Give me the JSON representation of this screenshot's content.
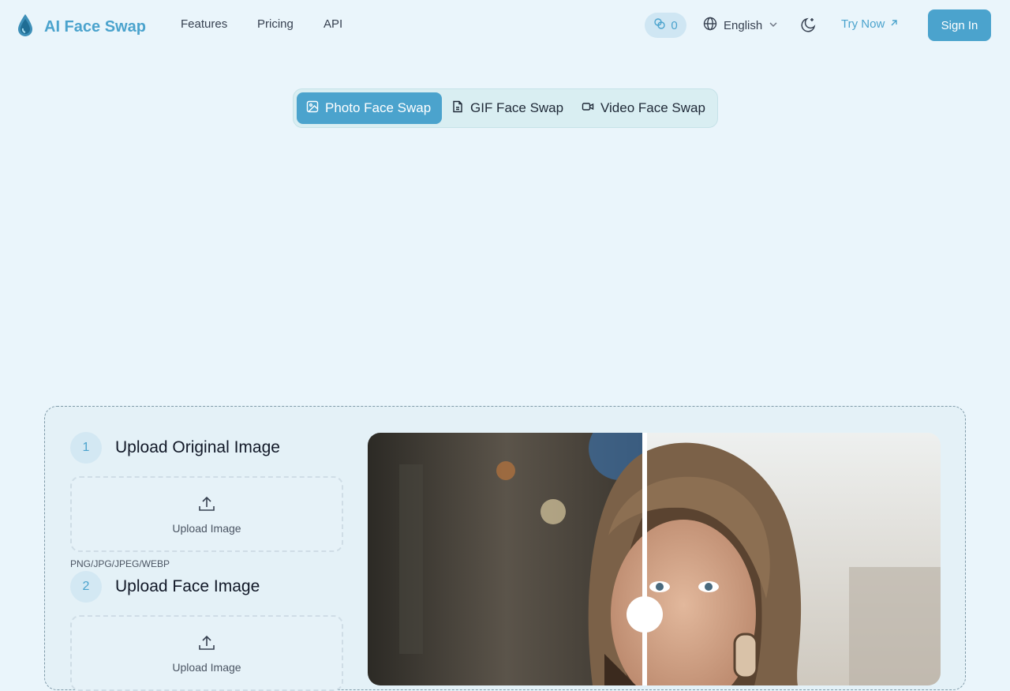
{
  "brand": {
    "name": "AI Face Swap",
    "icon": "water-drop-logo"
  },
  "nav": {
    "features": "Features",
    "pricing": "Pricing",
    "api": "API",
    "credits": "0",
    "language": "English",
    "try_now": "Try Now",
    "sign_in": "Sign In"
  },
  "tabs": [
    {
      "label": "Photo Face Swap",
      "icon": "image-icon",
      "active": true
    },
    {
      "label": "GIF Face Swap",
      "icon": "file-icon",
      "active": false
    },
    {
      "label": "Video Face Swap",
      "icon": "video-icon",
      "active": false
    }
  ],
  "steps": [
    {
      "number": "1",
      "title": "Upload Original Image",
      "upload_label": "Upload Image",
      "hint": "PNG/JPG/JPEG/WEBP"
    },
    {
      "number": "2",
      "title": "Upload Face Image",
      "upload_label": "Upload Image"
    }
  ],
  "colors": {
    "accent": "#4ba3cd",
    "background": "#eaf5fb"
  }
}
